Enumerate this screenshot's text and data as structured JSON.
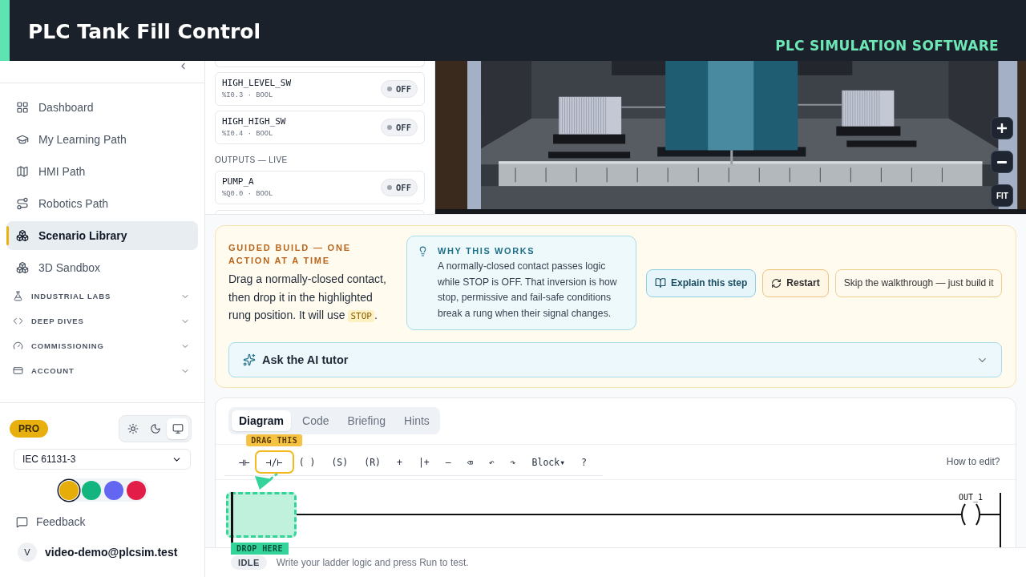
{
  "banner": {
    "title": "PLC Tank Fill Control",
    "subtitle": "PLC SIMULATION SOFTWARE"
  },
  "sidebar": {
    "items": [
      {
        "label": "Dashboard",
        "selected": false
      },
      {
        "label": "My Learning Path",
        "selected": false
      },
      {
        "label": "HMI Path",
        "selected": false
      },
      {
        "label": "Robotics Path",
        "selected": false
      },
      {
        "label": "Scenario Library",
        "selected": true
      },
      {
        "label": "3D Sandbox",
        "selected": false
      }
    ],
    "sections": [
      {
        "label": "INDUSTRIAL LABS",
        "expanded": false
      },
      {
        "label": "DEEP DIVES",
        "expanded": false
      },
      {
        "label": "COMMISSIONING",
        "expanded": false
      },
      {
        "label": "ACCOUNT",
        "expanded": false
      }
    ],
    "plan_badge": "PRO",
    "theme_options": [
      {
        "selected": false
      },
      {
        "selected": false
      },
      {
        "selected": true
      }
    ],
    "standard_select": {
      "value": "IEC 61131-3"
    },
    "accent_colors": [
      {
        "color": "#e6ad08",
        "selected": true
      },
      {
        "color": "#12b57e",
        "selected": false
      },
      {
        "color": "#6366f1",
        "selected": false
      },
      {
        "color": "#e11d48",
        "selected": false
      }
    ],
    "feedback": "Feedback",
    "user": {
      "initial": "V",
      "email": "video-demo@plcsim.test"
    }
  },
  "io_panel": {
    "inputs": [
      {
        "name": "HIGH_LEVEL_SW",
        "detail": "%I0.3 · BOOL",
        "value": "OFF",
        "on": false
      },
      {
        "name": "HIGH_HIGH_SW",
        "detail": "%I0.4 · BOOL",
        "value": "OFF",
        "on": false
      }
    ],
    "outputs_heading": "OUTPUTS — LIVE",
    "outputs": [
      {
        "name": "PUMP_A",
        "detail": "%Q0.0 · BOOL",
        "value": "OFF",
        "on": false
      }
    ]
  },
  "scene": {
    "fit_label": "FIT"
  },
  "guided_build": {
    "heading": "GUIDED BUILD — ONE ACTION AT A TIME",
    "instruction": {
      "before": "Drag a normally-closed contact, then drop it in the highlighted rung position. It will use ",
      "code": "STOP",
      "after": "."
    },
    "why": {
      "heading": "WHY THIS WORKS",
      "body": "A normally-closed contact passes logic while STOP is OFF. That inversion is how stop, permissive and fail-safe conditions break a rung when their signal changes."
    },
    "actions": [
      {
        "label": "Explain this step",
        "kind": "explain"
      },
      {
        "label": "Restart",
        "kind": "restart"
      },
      {
        "label": "Skip the walkthrough — just build it",
        "kind": "skip"
      }
    ],
    "tutor": {
      "label": "Ask the AI tutor",
      "expanded": false
    }
  },
  "editor": {
    "tabs": [
      {
        "label": "Diagram",
        "selected": true
      },
      {
        "label": "Code",
        "selected": false
      },
      {
        "label": "Briefing",
        "selected": false
      },
      {
        "label": "Hints",
        "selected": false
      }
    ],
    "toolbar": [
      {
        "label": "⊣⊢",
        "highlighted": false
      },
      {
        "label": "⊣/⊢",
        "highlighted": true
      },
      {
        "label": "( )",
        "highlighted": false
      },
      {
        "label": "(S)",
        "highlighted": false
      },
      {
        "label": "(R)",
        "highlighted": false
      },
      {
        "label": "+",
        "highlighted": false
      },
      {
        "label": "|+",
        "highlighted": false
      },
      {
        "label": "–",
        "highlighted": false
      },
      {
        "label": "⌫",
        "highlighted": false
      },
      {
        "label": "↶",
        "highlighted": false
      },
      {
        "label": "↷",
        "highlighted": false
      },
      {
        "label": "Block▾",
        "highlighted": false
      },
      {
        "label": "?",
        "highlighted": false
      }
    ],
    "drag_hint": "DRAG THIS",
    "help_link": "How to edit?",
    "rung": {
      "coil_label": "OUT_1",
      "drop_hint": "DROP HERE"
    }
  },
  "status_bar": {
    "state": "IDLE",
    "message": "Write your ladder logic and press Run to test."
  }
}
